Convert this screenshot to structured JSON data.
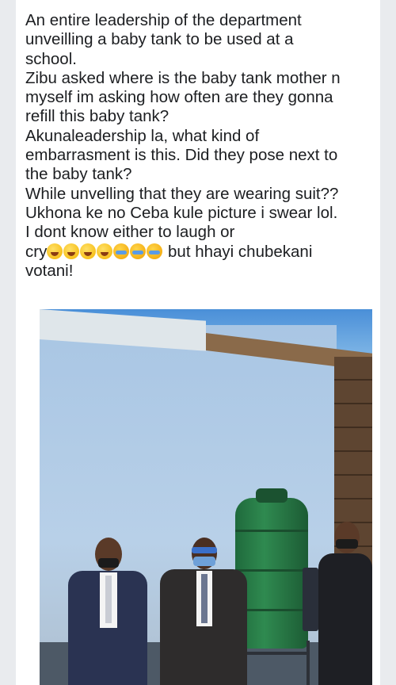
{
  "post": {
    "lines": [
      "An entire leadership of the department",
      "unveilling a baby tank to be used at a",
      "school.",
      "Zibu asked where is the baby tank mother n",
      "myself im asking how often are they gonna",
      "refill this baby tank?",
      "Akunaleadership la, what kind of",
      "embarrasment is this. Did they pose next to",
      "the baby tank?",
      "While unvelling that they are wearing suit??",
      "Ukhona ke no Ceba kule picture i swear lol.",
      "I dont know either to laugh or"
    ],
    "last_line_start": "cry",
    "last_line_end": " but hhayi chubekani",
    "final_line": "votani!",
    "emojis": [
      "rolling-on-floor-laughing-icon",
      "rolling-on-floor-laughing-icon",
      "rolling-on-floor-laughing-icon",
      "rolling-on-floor-laughing-icon",
      "loudly-crying-icon",
      "loudly-crying-icon",
      "loudly-crying-icon"
    ]
  },
  "photo": {
    "description_icons": [
      "green-water-tank",
      "hand-sanitizer-dispenser"
    ]
  },
  "colors": {
    "tank_green": "#2f8a50",
    "wall_blue": "#b8d0e8",
    "sky_blue": "#4a8fd8"
  }
}
